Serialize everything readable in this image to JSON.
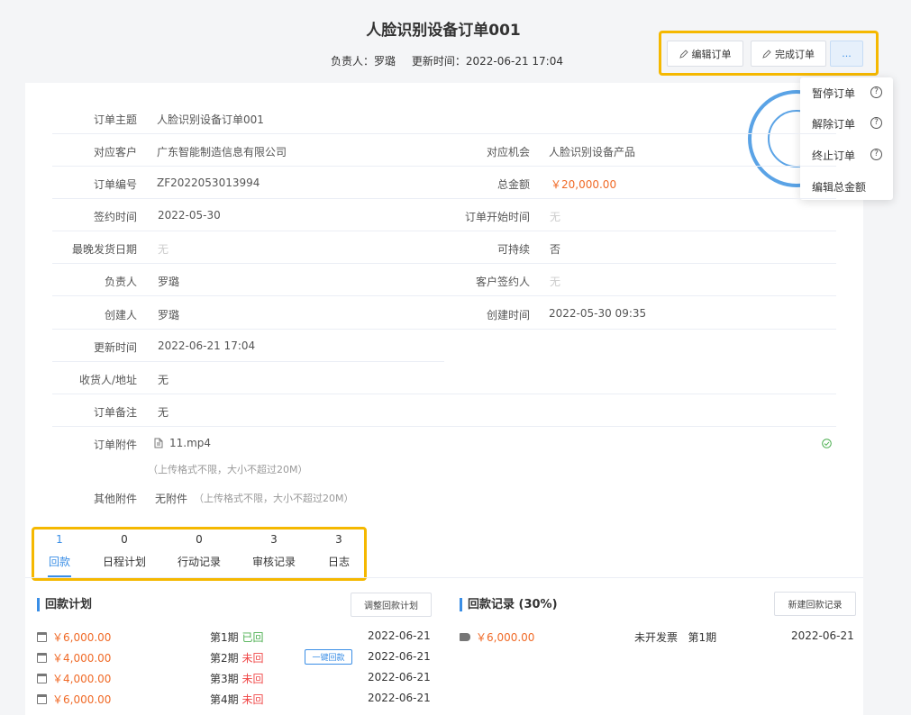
{
  "header": {
    "title": "人脸识别设备订单001",
    "owner": "负责人：罗璐",
    "updated": "更新时间：2022-06-21 17:04"
  },
  "actions": {
    "edit_label": "编辑订单",
    "complete_label": "完成订单",
    "more_label": "..."
  },
  "dropdown": {
    "items": [
      "暂停订单",
      "解除订单",
      "终止订单",
      "编辑总金额"
    ]
  },
  "details": {
    "subject_label": "订单主题",
    "subject": "人脸识别设备订单001",
    "customer_label": "对应客户",
    "customer": "广东智能制造信息有限公司",
    "opportunity_label": "对应机会",
    "opportunity": "人脸识别设备产品",
    "number_label": "订单编号",
    "number": "ZF2022053013994",
    "amount_label": "总金额",
    "amount": "￥20,000.00",
    "sign_date_label": "签约时间",
    "sign_date": "2022-05-30",
    "start_label": "订单开始时间",
    "start": "无",
    "latest_ship_label": "最晚发货日期",
    "latest_ship": "无",
    "sustain_label": "可持续",
    "sustain": "否",
    "owner_label": "负责人",
    "owner": "罗璐",
    "signer_label": "客户签约人",
    "signer": "无",
    "creator_label": "创建人",
    "creator": "罗璐",
    "created_label": "创建时间",
    "created": "2022-05-30 09:35",
    "updated_label": "更新时间",
    "updated": "2022-06-21 17:04",
    "address_label": "收货人/地址",
    "address": "无",
    "remark_label": "订单备注",
    "remark": "无",
    "attach_label": "订单附件",
    "attach_file": "11.mp4",
    "attach_hint": "（上传格式不限，大小不超过20M）",
    "other_label": "其他附件",
    "other": "无附件",
    "other_hint": "（上传格式不限，大小不超过20M）"
  },
  "tabs": [
    {
      "count": "1",
      "label": "回款"
    },
    {
      "count": "0",
      "label": "日程计划"
    },
    {
      "count": "0",
      "label": "行动记录"
    },
    {
      "count": "3",
      "label": "审核记录"
    },
    {
      "count": "3",
      "label": "日志"
    }
  ],
  "plan": {
    "title": "回款计划",
    "adjust_label": "调整回款计划",
    "one_click_label": "一键回款",
    "rows": [
      {
        "amount": "￥6,000.00",
        "period": "第1期",
        "status": "已回",
        "date": "2022-06-21"
      },
      {
        "amount": "￥4,000.00",
        "period": "第2期",
        "status": "未回",
        "date": "2022-06-21"
      },
      {
        "amount": "￥4,000.00",
        "period": "第3期",
        "status": "未回",
        "date": "2022-06-21"
      },
      {
        "amount": "￥6,000.00",
        "period": "第4期",
        "status": "未回",
        "date": "2022-06-21"
      }
    ]
  },
  "records": {
    "title": "回款记录 (30%)",
    "new_label": "新建回款记录",
    "rows": [
      {
        "amount": "￥6,000.00",
        "invoice": "未开发票",
        "period": "第1期",
        "date": "2022-06-21"
      }
    ]
  },
  "colors": {
    "accent": "#3a8ee6",
    "highlight": "#f5b800",
    "money": "#f06a27",
    "success": "#4caf50",
    "danger": "#f04848"
  }
}
